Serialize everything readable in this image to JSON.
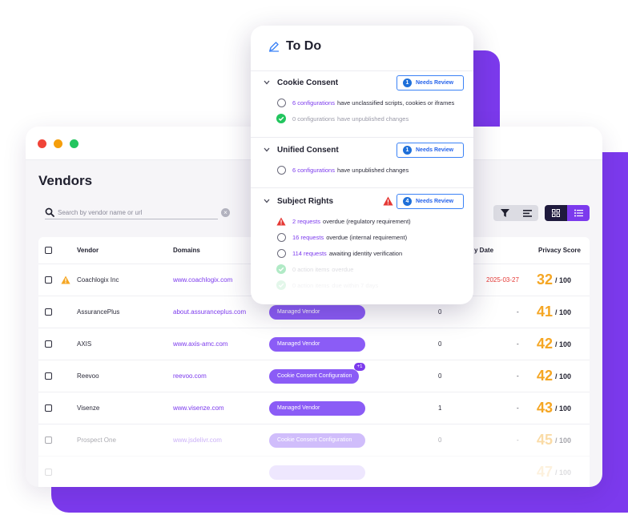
{
  "window": {
    "title": "Vendors",
    "search_placeholder": "Search by vendor name or url"
  },
  "table": {
    "headers": {
      "vendor": "Vendor",
      "domains": "Domains",
      "date": "y Date",
      "privacy_score": "Privacy Score"
    },
    "rows": [
      {
        "vendor": "Coachlogix Inc",
        "domain": "www.coachlogix.com",
        "tag": "",
        "badge": "",
        "count": "",
        "date": "2025-03-27",
        "score": "32",
        "score_max": "/ 100",
        "warning": true
      },
      {
        "vendor": "AssurancePlus",
        "domain": "about.assuranceplus.com",
        "tag": "Managed Vendor",
        "badge": "",
        "count": "0",
        "date": "-",
        "score": "41",
        "score_max": "/ 100",
        "warning": false
      },
      {
        "vendor": "AXIS",
        "domain": "www.axis-amc.com",
        "tag": "Managed Vendor",
        "badge": "",
        "count": "0",
        "date": "-",
        "score": "42",
        "score_max": "/ 100",
        "warning": false
      },
      {
        "vendor": "Reevoo",
        "domain": "reevoo.com",
        "tag": "Cookie Consent Configuration",
        "badge": "+1",
        "count": "0",
        "date": "-",
        "score": "42",
        "score_max": "/ 100",
        "warning": false
      },
      {
        "vendor": "Visenze",
        "domain": "www.visenze.com",
        "tag": "Managed Vendor",
        "badge": "",
        "count": "1",
        "date": "-",
        "score": "43",
        "score_max": "/ 100",
        "warning": false
      },
      {
        "vendor": "Prospect One",
        "domain": "www.jsdelivr.com",
        "tag": "Cookie Consent Configuration",
        "badge": "",
        "count": "0",
        "date": "-",
        "score": "45",
        "score_max": "/ 100",
        "warning": false
      },
      {
        "vendor": "",
        "domain": "",
        "tag": "",
        "badge": "",
        "count": "",
        "date": "",
        "score": "47",
        "score_max": "/ 100",
        "warning": false
      }
    ]
  },
  "todo": {
    "title": "To Do",
    "sections": [
      {
        "label": "Cookie Consent",
        "review_count": "1",
        "review_label": "Needs Review",
        "items": [
          {
            "link": "6 configurations",
            "text": "have unclassified scripts, cookies or iframes"
          },
          {
            "link": "0 configurations",
            "text": "have unpublished changes"
          }
        ]
      },
      {
        "label": "Unified Consent",
        "review_count": "1",
        "review_label": "Needs Review",
        "items": [
          {
            "link": "6 configurations",
            "text": "have unpublished changes"
          }
        ]
      },
      {
        "label": "Subject Rights",
        "review_count": "4",
        "review_label": "Needs Review",
        "items": [
          {
            "link": "2 requests",
            "text": "overdue (regulatory requirement)"
          },
          {
            "link": "16 requests",
            "text": "overdue (internal requirement)"
          },
          {
            "link": "114 requests",
            "text": "awaiting identity verification"
          },
          {
            "link": "0 action items",
            "text": "overdue"
          },
          {
            "link": "0 action items",
            "text": "due within 7 days"
          }
        ]
      }
    ]
  },
  "colors": {
    "brand_purple": "#7c3aed",
    "score_orange": "#f5a623",
    "alert_red": "#e53935",
    "review_blue": "#2563eb"
  }
}
